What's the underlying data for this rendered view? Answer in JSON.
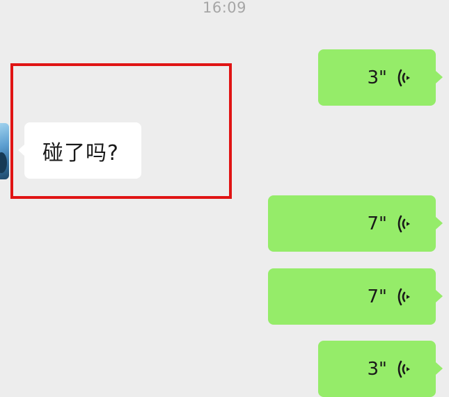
{
  "chat": {
    "timestamp": "16:09",
    "incoming": {
      "text": "碰了吗?"
    },
    "voice_messages": [
      {
        "duration": "3\""
      },
      {
        "duration": "7\""
      },
      {
        "duration": "7\""
      },
      {
        "duration": "3\""
      }
    ]
  },
  "icons": {
    "voice": "voice-wave-icon",
    "avatar": "contact-avatar"
  },
  "colors": {
    "background": "#ededed",
    "incoming_bubble": "#ffffff",
    "outgoing_bubble": "#95ec69",
    "highlight_border": "#e01414",
    "timestamp_text": "#a6a6a6"
  }
}
